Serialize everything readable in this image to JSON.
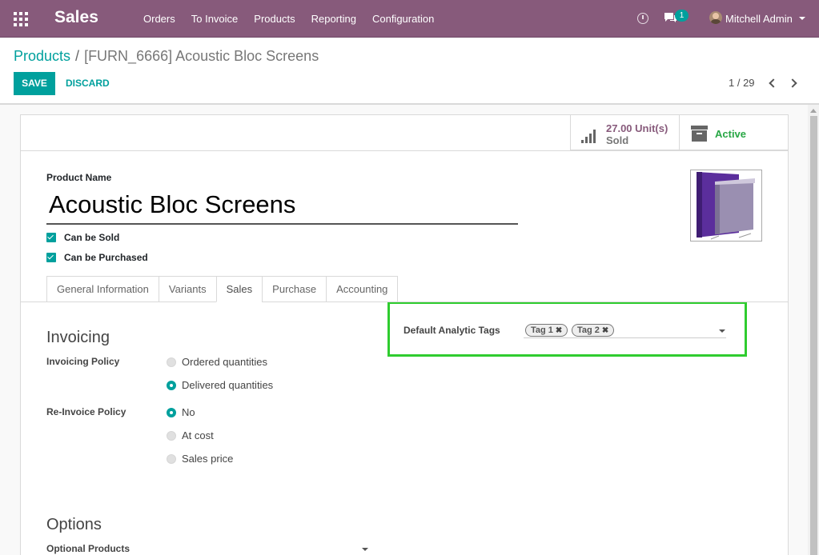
{
  "navbar": {
    "app_title": "Sales",
    "menu": [
      "Orders",
      "To Invoice",
      "Products",
      "Reporting",
      "Configuration"
    ],
    "chat_badge": "1",
    "user_name": "Mitchell Admin",
    "bg_color": "#875a7b"
  },
  "breadcrumb": {
    "parent": "Products",
    "separator": "/",
    "current": "[FURN_6666] Acoustic Bloc Screens"
  },
  "actions": {
    "save": "SAVE",
    "discard": "DISCARD"
  },
  "pager": {
    "value": "1 / 29"
  },
  "stat_buttons": {
    "sold_value": "27.00 Unit(s)",
    "sold_label": "Sold",
    "active_label": "Active"
  },
  "product": {
    "name_label": "Product Name",
    "name": "Acoustic Bloc Screens",
    "can_be_sold": "Can be Sold",
    "can_be_purchased": "Can be Purchased"
  },
  "tabs": [
    "General Information",
    "Variants",
    "Sales",
    "Purchase",
    "Accounting"
  ],
  "active_tab": "Sales",
  "invoicing": {
    "title": "Invoicing",
    "policy_label": "Invoicing Policy",
    "policy_options": [
      "Ordered quantities",
      "Delivered quantities"
    ],
    "policy_selected": "Delivered quantities",
    "reinvoice_label": "Re-Invoice Policy",
    "reinvoice_options": [
      "No",
      "At cost",
      "Sales price"
    ],
    "reinvoice_selected": "No"
  },
  "analytic": {
    "label": "Default Analytic Tags",
    "tags": [
      "Tag 1",
      "Tag 2"
    ]
  },
  "options": {
    "title": "Options",
    "optional_products_label": "Optional Products"
  },
  "colors": {
    "accent": "#00a09d",
    "brand": "#875a7b",
    "active": "#28a745",
    "highlight": "#2fcc2f"
  }
}
